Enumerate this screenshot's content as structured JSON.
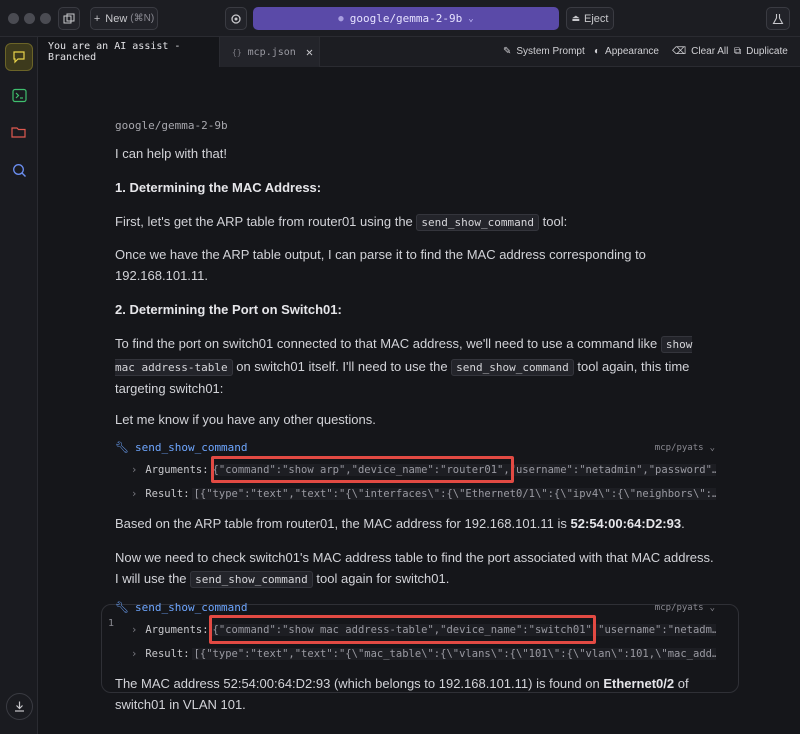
{
  "titlebar": {
    "new_label": "New",
    "new_shortcut": "(⌘N)",
    "model_name": "google/gemma-2-9b",
    "eject_label": "Eject"
  },
  "tabs": [
    {
      "label": "You are an AI assist - Branched"
    },
    {
      "label": "mcp.json",
      "icon": "{}"
    }
  ],
  "toolbar": {
    "system_prompt": "System Prompt",
    "appearance": "Appearance",
    "clear_all": "Clear All",
    "duplicate": "Duplicate"
  },
  "chat": {
    "model_tag": "google/gemma-2-9b",
    "p1": "I can help with that!",
    "h1": "1. Determining the MAC Address:",
    "p2_a": "First, let's get the ARP table from router01 using the",
    "p2_code": "send_show_command",
    "p2_b": "tool:",
    "p3": "Once we have the ARP table output, I can parse it to find the MAC address corresponding to 192.168.101.11.",
    "h2": "2. Determining the Port on Switch01:",
    "p4_a": "To find the port on switch01 connected to that MAC address, we'll need to use a command like",
    "p4_code1": "show mac address-table",
    "p4_b": "on switch01 itself.  I'll need to use the",
    "p4_code2": "send_show_command",
    "p4_c": "tool again, this time targeting switch01:",
    "p5": "Let me know if you have any other questions.",
    "tool1": {
      "name": "send_show_command",
      "badge": "mcp/pyats",
      "args_label": "Arguments:",
      "args_value": "{\"command\":\"show arp\",\"device_name\":\"router01\",\"username\":\"netadmin\",\"password\"…",
      "result_label": "Result:",
      "result_value": "[{\"type\":\"text\",\"text\":\"{\\\"interfaces\\\":{\\\"Ethernet0/1\\\":{\\\"ipv4\\\":{\\\"neighbors\\\":…"
    },
    "p6_a": "Based on the ARP table from router01, the MAC address for 192.168.101.11 is",
    "p6_bold": "52:54:00:64:D2:93",
    "p6_b": ".",
    "p7_a": "Now we need to check switch01's MAC address table to find the port associated with that MAC address. I will use the",
    "p7_code": "send_show_command",
    "p7_b": "tool again for switch01.",
    "tool2": {
      "name": "send_show_command",
      "badge": "mcp/pyats",
      "args_label": "Arguments:",
      "args_value": "{\"command\":\"show mac address-table\",\"device_name\":\"switch01\",\"username\":\"netadm…",
      "result_label": "Result:",
      "result_value": "[{\"type\":\"text\",\"text\":\"{\\\"mac_table\\\":{\\\"vlans\\\":{\\\"101\\\":{\\\"vlan\\\":101,\\\"mac_add…"
    },
    "p8_a": "The MAC address 52:54:00:64:D2:93 (which belongs to 192.168.101.11) is found on",
    "p8_bold": "Ethernet0/2",
    "p8_b": "of switch01 in VLAN 101."
  },
  "colors": {
    "accent": "#5a4aa8",
    "link": "#6ea6ff",
    "highlight": "#e24a43"
  }
}
